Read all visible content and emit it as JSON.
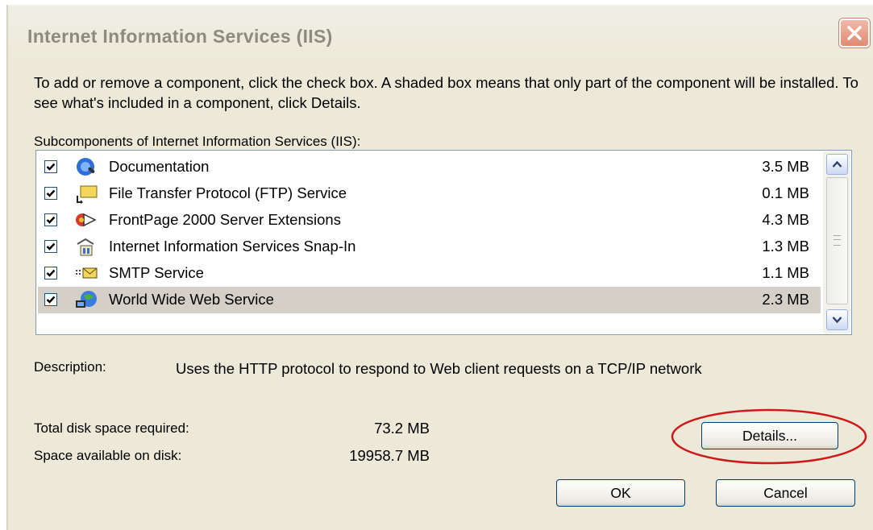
{
  "window": {
    "title": "Internet Information Services (IIS)",
    "close_icon": "close-icon"
  },
  "instructions": "To add or remove a component, click the check box. A shaded box means that only part of the component will be installed. To see what's included in a component, click Details.",
  "subcomponents": {
    "label": "Subcomponents of Internet Information Services (IIS):",
    "items": [
      {
        "label": "Documentation",
        "size": "3.5 MB",
        "checked": true,
        "icon": "documentation-icon"
      },
      {
        "label": "File Transfer Protocol (FTP) Service",
        "size": "0.1 MB",
        "checked": true,
        "icon": "ftp-folder-icon"
      },
      {
        "label": "FrontPage 2000 Server Extensions",
        "size": "4.3 MB",
        "checked": true,
        "icon": "frontpage-extensions-icon"
      },
      {
        "label": "Internet Information Services Snap-In",
        "size": "1.3 MB",
        "checked": true,
        "icon": "iis-snapin-icon"
      },
      {
        "label": "SMTP Service",
        "size": "1.1 MB",
        "checked": true,
        "icon": "smtp-mail-icon"
      },
      {
        "label": "World Wide Web Service",
        "size": "2.3 MB",
        "checked": true,
        "icon": "www-globe-icon",
        "selected": true
      }
    ]
  },
  "description": {
    "label": "Description:",
    "text": "Uses the HTTP protocol to respond to Web client requests on a TCP/IP network"
  },
  "disk": {
    "total_label": "Total disk space required:",
    "total_value": "73.2 MB",
    "available_label": "Space available on disk:",
    "available_value": "19958.7 MB"
  },
  "buttons": {
    "details": "Details...",
    "ok": "OK",
    "cancel": "Cancel"
  },
  "colors": {
    "dialog_bg": "#ECE9D8",
    "selected_row": "#D4D0C8",
    "annotation_ellipse": "#D01818"
  }
}
